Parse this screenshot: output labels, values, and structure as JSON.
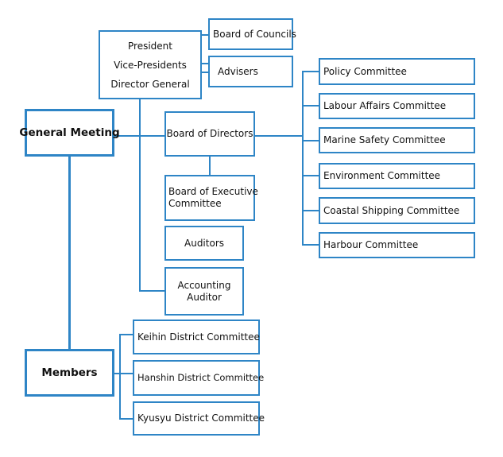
{
  "diagram": {
    "type": "organization-chart",
    "colors": {
      "border": "#2e85c6",
      "text": "#111111",
      "background": "#ffffff"
    },
    "nodes": {
      "general_meeting": "General Meeting",
      "members": "Members",
      "executives": [
        "President",
        "Vice-Presidents",
        "Director General"
      ],
      "board_of_councils": "Board of Councils",
      "advisers": "Advisers",
      "board_of_directors": "Board of Directors",
      "board_of_executive": [
        "Board of Executive",
        "Committee"
      ],
      "auditors": "Auditors",
      "accounting_auditor": [
        "Accounting",
        "Auditor"
      ],
      "committees": [
        "Policy Committee",
        "Labour Affairs Committee",
        "Marine Safety Committee",
        "Environment Committee",
        "Coastal Shipping Committee",
        "Harbour Committee"
      ],
      "district_committees": [
        "Keihin District Committee",
        "Hanshin District Committee",
        "Kyusyu District Committee"
      ]
    },
    "edges": [
      [
        "general_meeting",
        "board_of_directors"
      ],
      [
        "general_meeting",
        "members"
      ],
      [
        "executives",
        "board_of_councils"
      ],
      [
        "executives",
        "advisers"
      ],
      [
        "executives",
        "accounting_auditor"
      ],
      [
        "board_of_directors",
        "board_of_executive"
      ],
      [
        "board_of_directors",
        "committees"
      ],
      [
        "members",
        "district_committees"
      ]
    ]
  }
}
